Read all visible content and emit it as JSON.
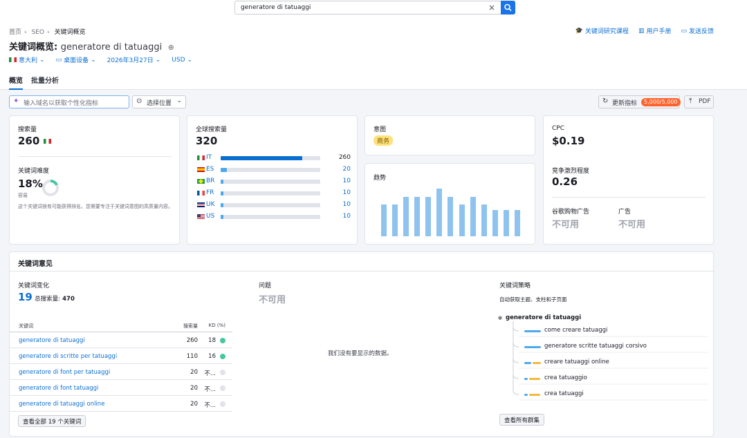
{
  "search": {
    "query": "generatore di tatuaggi"
  },
  "breadcrumb": [
    "首页",
    "SEO",
    "关键词概览"
  ],
  "top_links": [
    "关键词研究课程",
    "用户手册",
    "发送反馈"
  ],
  "title": {
    "prefix": "关键词概览:",
    "keyword": "generatore di tatuaggi"
  },
  "filters": {
    "country": "意大利",
    "device": "桌面设备",
    "date": "2026年3月27日",
    "currency": "USD"
  },
  "tabs": [
    "概览",
    "批量分析"
  ],
  "toolbar": {
    "domain_placeholder": "输入域名以获取个性化指标",
    "location": "选择位置",
    "refresh": "更新指标",
    "quota": "5,000/5,000",
    "pdf": "PDF"
  },
  "volume": {
    "label": "搜索量",
    "value": "260"
  },
  "difficulty": {
    "label": "关键词难度",
    "value": "18%",
    "level": "容易",
    "percent": 18,
    "note": "这个关键词很有可能获得排名。您需要专注于关键词意图的高质量内容。"
  },
  "global": {
    "label": "全球搜索量",
    "value": "320",
    "countries": [
      {
        "code": "IT",
        "flag": "it",
        "value": "260",
        "share": 0.82
      },
      {
        "code": "ES",
        "flag": "es",
        "value": "20",
        "share": 0.06
      },
      {
        "code": "BR",
        "flag": "br",
        "value": "10",
        "share": 0.03
      },
      {
        "code": "FR",
        "flag": "fr",
        "value": "10",
        "share": 0.03
      },
      {
        "code": "UK",
        "flag": "uk",
        "value": "10",
        "share": 0.03
      },
      {
        "code": "US",
        "flag": "us",
        "value": "10",
        "share": 0.03
      }
    ]
  },
  "intent": {
    "label": "意图",
    "value": "商务"
  },
  "trend": {
    "label": "趋势",
    "values": [
      0.63,
      0.63,
      0.78,
      0.78,
      0.78,
      0.95,
      0.78,
      0.63,
      0.78,
      0.63,
      0.52,
      0.52,
      0.52
    ]
  },
  "cpc": {
    "label": "CPC",
    "value": "$0.19"
  },
  "competition": {
    "label": "竞争激烈程度",
    "value": "0.26"
  },
  "shopping": {
    "label": "谷歌购物广告",
    "value": "不可用"
  },
  "ads": {
    "label": "广告",
    "value": "不可用"
  },
  "ideas": {
    "title": "关键词意见",
    "variations": {
      "label": "关键词变化",
      "count": "19",
      "total_label": "总搜索量:",
      "total": "470",
      "col_keyword": "关键词",
      "col_volume": "搜索量",
      "col_kd": "KD (%)",
      "rows": [
        {
          "kw": "generatore di tatuaggi",
          "vol": "260",
          "kd": "18",
          "dot": "green"
        },
        {
          "kw": "generatore di scritte per tatuaggi",
          "vol": "110",
          "kd": "16",
          "dot": "green"
        },
        {
          "kw": "generatore di font per tatuaggi",
          "vol": "20",
          "kd": "不...",
          "dot": "grey"
        },
        {
          "kw": "generatore di font tatuaggi",
          "vol": "20",
          "kd": "不...",
          "dot": "grey"
        },
        {
          "kw": "generatore di tatuaggi online",
          "vol": "20",
          "kd": "不...",
          "dot": "grey"
        }
      ],
      "button": "查看全部 19 个关键词"
    },
    "questions": {
      "label": "问题",
      "value": "不可用",
      "empty": "我们没有要显示的数据。"
    },
    "strategy": {
      "label": "关键词策略",
      "subtitle": "自动获取主题、支柱和子页面",
      "root": "generatore di tatuaggi",
      "children": [
        "come creare tatuaggi",
        "generatore scritte tatuaggi corsivo",
        "creare tatuaggi online",
        "crea tatuaggio",
        "crea tatuaggi"
      ],
      "button": "查看所有群集"
    }
  }
}
